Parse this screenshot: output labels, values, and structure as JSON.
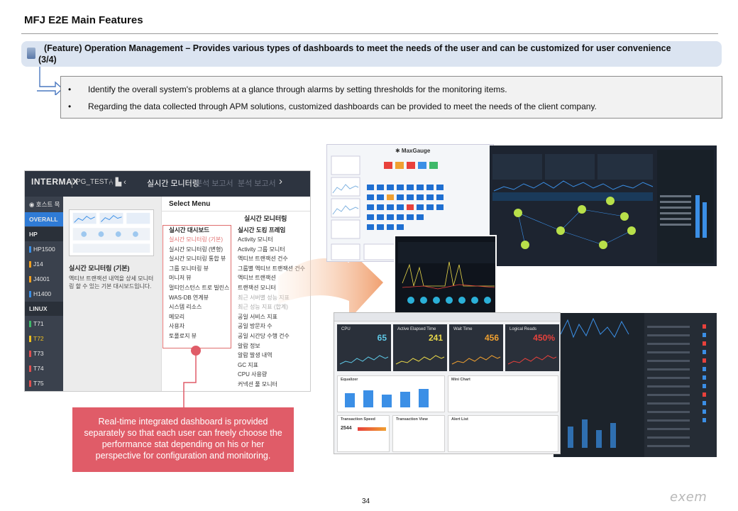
{
  "header": {
    "title": "MFJ E2E Main Features"
  },
  "feature": {
    "text": "(Feature) Operation Management – Provides various types of dashboards to meet the needs of the user and can be customized for user convenience (3/4)"
  },
  "bullets": [
    "Identify the overall system's problems at a glance through alarms by setting thresholds for the monitoring items.",
    "Regarding the data collected through APM solutions, customized dashboards can be provided to meet the needs of the client company."
  ],
  "bullet_glyph": "•",
  "left_screenshot": {
    "logo": "INTERMAX",
    "tab": "PG_TEST",
    "icons": "⑃ ▙ ‹",
    "realtime_label": "실시간 모니터링",
    "report_label_1": "분석 보고서",
    "report_label_2": "분석 보고서",
    "next_glyph": "›",
    "sidebar": [
      {
        "label": "◉ 호스트 목",
        "kind": "plain",
        "color": "#e4e4e4"
      },
      {
        "label": "OVERALL",
        "kind": "active",
        "color": "#ffffff"
      },
      {
        "label": "HP",
        "kind": "group",
        "color": "#ffffff"
      },
      {
        "label": "HP1500",
        "kind": "item",
        "color": "#3b8fe6"
      },
      {
        "label": "J14",
        "kind": "item",
        "color": "#f0a020"
      },
      {
        "label": "J4001",
        "kind": "item",
        "color": "#f0a020"
      },
      {
        "label": "H1400",
        "kind": "item",
        "color": "#3b8fe6"
      },
      {
        "label": "LINUX",
        "kind": "group",
        "color": "#ffffff"
      },
      {
        "label": "T71",
        "kind": "item",
        "color": "#3fb96a"
      },
      {
        "label": "T72",
        "kind": "item",
        "color": "#f0c020"
      },
      {
        "label": "T73",
        "kind": "item",
        "color": "#e05050"
      },
      {
        "label": "T74",
        "kind": "item",
        "color": "#e05050"
      },
      {
        "label": "T75",
        "kind": "item",
        "color": "#e05050"
      }
    ],
    "card_title": "실시간 모니터링 (기본)",
    "card_desc": "액티브 트랜잭션 내역을 상세 모니터링 할 수 있는 기본 대시보드입니다.",
    "menu_title": "Select Menu",
    "col2_title": "실시간 모니터링",
    "col1_head": "실시간 대시보드",
    "col2_head": "실시간 도킹 프레임",
    "col1_items": [
      {
        "label": "실시간 모니터링 (기본)",
        "style": "hl"
      },
      {
        "label": "실시간 모니터링 (변형)",
        "style": ""
      },
      {
        "label": "실시간 모니터링 통합 뷰",
        "style": ""
      },
      {
        "label": "그룹 모니터링 뷰",
        "style": ""
      },
      {
        "label": "머니저 뷰",
        "style": ""
      },
      {
        "label": "멀티인스턴스 트로 빌린스",
        "style": ""
      },
      {
        "label": "WAS-DB 연계뷰",
        "style": ""
      },
      {
        "label": "시스템 리소스",
        "style": ""
      },
      {
        "label": "메모리",
        "style": ""
      },
      {
        "label": "사용자",
        "style": ""
      },
      {
        "label": "토폴로지 뷰",
        "style": ""
      }
    ],
    "col2_items": [
      {
        "label": "Activity 모니터",
        "style": ""
      },
      {
        "label": "Activity 그룹 모니터",
        "style": ""
      },
      {
        "label": "액티브 트랜잭션 건수",
        "style": ""
      },
      {
        "label": "그룹별 액티브 트랜잭션 건수",
        "style": ""
      },
      {
        "label": "액티브 트랜잭션",
        "style": ""
      },
      {
        "label": "트랜잭션 모니터",
        "style": ""
      },
      {
        "label": "최근 서버별 성능 지표",
        "style": "dim"
      },
      {
        "label": "최근 성능 지표 (합계)",
        "style": "dim"
      },
      {
        "label": "공일 서비스 지표",
        "style": ""
      },
      {
        "label": "공일 방문자 수",
        "style": ""
      },
      {
        "label": "공일 시간당 수행 건수",
        "style": ""
      },
      {
        "label": "알람 정보",
        "style": ""
      },
      {
        "label": "알람 발생 내역",
        "style": ""
      },
      {
        "label": "GC 지표",
        "style": ""
      },
      {
        "label": "CPU 사용량",
        "style": ""
      },
      {
        "label": "커넥션 풀 모니터",
        "style": ""
      }
    ]
  },
  "callout": {
    "text": "Real-time integrated dashboard is provided separately so that each user can freely choose the performance stat depending on his or her perspective for configuration and monitoring."
  },
  "collage": {
    "maxgauge_logo": "✱ MaxGauge",
    "tiles": [
      {
        "label": "CPU",
        "value": "65",
        "color": "#5ec8e6"
      },
      {
        "label": "Active Elapsed Time",
        "value": "241",
        "color": "#e9d84a"
      },
      {
        "label": "Wait Time",
        "value": "456",
        "color": "#f0a030"
      },
      {
        "label": "Logical Reads",
        "value": "450%",
        "color": "#e8413c"
      }
    ],
    "panels": [
      "Equalizer",
      "Mini Chart",
      "Transaction Speed",
      "Transaction View",
      "Alert List"
    ],
    "speed_value": "2544"
  },
  "footer": {
    "page_number": "34",
    "brand": "exem"
  }
}
